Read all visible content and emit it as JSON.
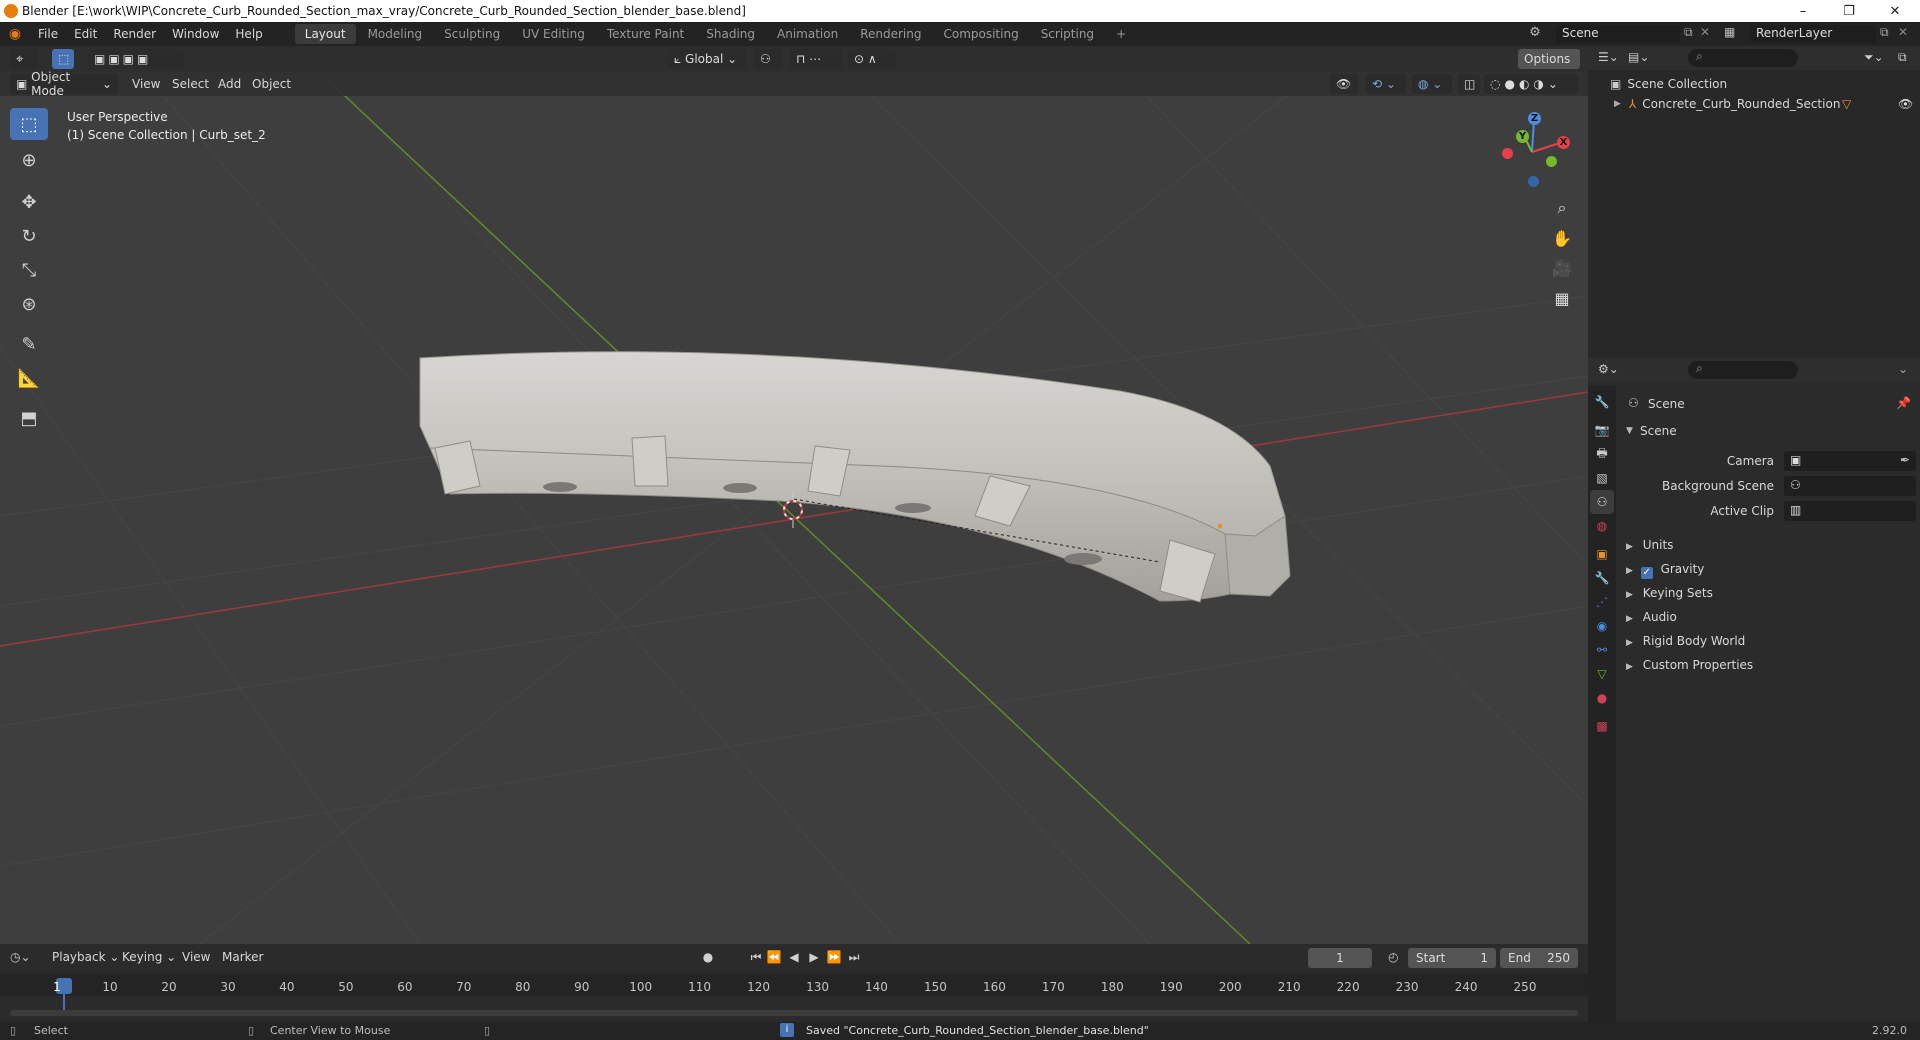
{
  "titlebar": {
    "title": "Blender [E:\\work\\WIP\\Concrete_Curb_Rounded_Section_max_vray/Concrete_Curb_Rounded_Section_blender_base.blend]",
    "minimize": "–",
    "maximize": "❐",
    "close": "✕"
  },
  "menus": [
    "File",
    "Edit",
    "Render",
    "Window",
    "Help"
  ],
  "workspaces": [
    "Layout",
    "Modeling",
    "Sculpting",
    "UV Editing",
    "Texture Paint",
    "Shading",
    "Animation",
    "Rendering",
    "Compositing",
    "Scripting"
  ],
  "workspace_add": "+",
  "top_right": {
    "scene": "Scene",
    "view_layer": "RenderLayer"
  },
  "viewport": {
    "mode": "Object Mode",
    "header_menus": [
      "View",
      "Select",
      "Add",
      "Object"
    ],
    "orientation": "Global",
    "options": "Options",
    "perspective_label": "User Perspective",
    "collection_label": "(1) Scene Collection | Curb_set_2",
    "gizmo": {
      "x": "X",
      "y": "Y",
      "z": "Z"
    }
  },
  "outliner": {
    "root": "Scene Collection",
    "items": [
      {
        "label": "Concrete_Curb_Rounded_Section"
      }
    ]
  },
  "properties": {
    "context": "Scene",
    "section": "Scene",
    "fields": [
      {
        "label": "Camera"
      },
      {
        "label": "Background Scene"
      },
      {
        "label": "Active Clip"
      }
    ],
    "panels": [
      {
        "label": "Units",
        "checkbox": false
      },
      {
        "label": "Gravity",
        "checkbox": true
      },
      {
        "label": "Keying Sets",
        "checkbox": false
      },
      {
        "label": "Audio",
        "checkbox": false
      },
      {
        "label": "Rigid Body World",
        "checkbox": false
      },
      {
        "label": "Custom Properties",
        "checkbox": false
      }
    ]
  },
  "timeline": {
    "menus": [
      "Playback",
      "Keying",
      "View",
      "Marker"
    ],
    "current_frame": "1",
    "start_label": "Start",
    "start": "1",
    "end_label": "End",
    "end": "250",
    "ticks": [
      "1",
      "10",
      "20",
      "30",
      "40",
      "50",
      "60",
      "70",
      "80",
      "90",
      "100",
      "110",
      "120",
      "130",
      "140",
      "150",
      "160",
      "170",
      "180",
      "190",
      "200",
      "210",
      "220",
      "230",
      "240",
      "250"
    ]
  },
  "status": {
    "select": "Select",
    "center_view": "Center View to Mouse",
    "message": "Saved \"Concrete_Curb_Rounded_Section_blender_base.blend\"",
    "version": "2.92.0"
  },
  "colors": {
    "accent": "#4772b3",
    "x_axis": "#e6414b",
    "y_axis": "#76b82a",
    "z_axis": "#4a8fe0",
    "origin": "#e8912c"
  }
}
